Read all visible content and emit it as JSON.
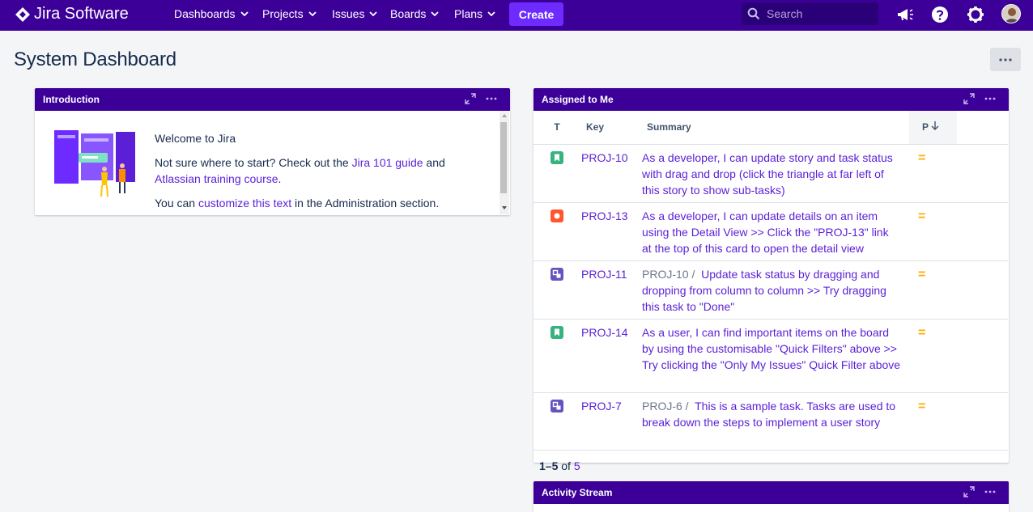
{
  "nav": {
    "product": "Jira Software",
    "items": [
      "Dashboards",
      "Projects",
      "Issues",
      "Boards",
      "Plans"
    ],
    "create": "Create",
    "search_placeholder": "Search"
  },
  "page": {
    "title": "System Dashboard",
    "more": "⋯"
  },
  "intro": {
    "title": "Introduction",
    "welcome": "Welcome to Jira",
    "line2_a": "Not sure where to start? Check out the ",
    "line2_link1": "Jira 101 guide",
    "line2_b": " and",
    "line2_link2": "Atlassian training course",
    "line2_c": ".",
    "line3_a": "You can ",
    "line3_link": "customize this text",
    "line3_b": " in the Administration section."
  },
  "assigned": {
    "title": "Assigned to Me",
    "columns": {
      "t": "T",
      "key": "Key",
      "summary": "Summary",
      "p": "P"
    },
    "rows": [
      {
        "type": "story",
        "type_color": "#36b37e",
        "key": "PROJ-10",
        "parent": "",
        "summary": "As a developer, I can update story and task status with drag and drop (click the triangle at far left of this story to show sub-tasks)",
        "priority": "="
      },
      {
        "type": "bug",
        "type_color": "#ff5630",
        "key": "PROJ-13",
        "parent": "",
        "summary": "As a developer, I can update details on an item using the Detail View >> Click the \"PROJ-13\" link at the top of this card to open the detail view",
        "priority": "="
      },
      {
        "type": "subtask",
        "type_color": "#6554c0",
        "key": "PROJ-11",
        "parent": "PROJ-10 /",
        "summary": "Update task status by dragging and dropping from column to column >> Try dragging this task to \"Done\"",
        "priority": "="
      },
      {
        "type": "story",
        "type_color": "#36b37e",
        "key": "PROJ-14",
        "parent": "",
        "summary": "As a user, I can find important items on the board by using the customisable \"Quick Filters\" above >> Try clicking the \"Only My Issues\" Quick Filter above",
        "priority": "="
      },
      {
        "type": "subtask",
        "type_color": "#6554c0",
        "key": "PROJ-7",
        "parent": "PROJ-6 /",
        "summary": "This is a sample task. Tasks are used to break down the steps to implement a user story",
        "priority": "="
      }
    ],
    "pager_range": "1–5",
    "pager_of": " of ",
    "pager_total": "5"
  },
  "activity": {
    "title": "Activity Stream"
  },
  "colors": {
    "nav_bg": "#3c0099",
    "create_bg": "#6d2bff",
    "link": "#5a1fd6",
    "priority_medium": "#ffab00"
  }
}
